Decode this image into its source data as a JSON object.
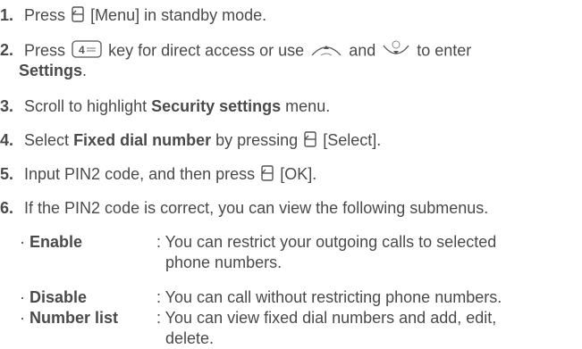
{
  "steps": [
    {
      "num": "1.",
      "pre": "Press",
      "post": "[Menu] in standby mode."
    },
    {
      "num": "2.",
      "pre": "Press",
      "mid1": "key for direct access or use",
      "mid2": "and",
      "post": "to enter",
      "bold_line2": "Settings",
      "tail_line2": "."
    },
    {
      "num": "3.",
      "pre": "Scroll to highlight",
      "bold": "Security settings",
      "post": "menu."
    },
    {
      "num": "4.",
      "pre": "Select",
      "bold": "Fixed dial number",
      "mid": "by pressing",
      "post": "[Select]."
    },
    {
      "num": "5.",
      "pre": "Input PIN2 code, and then press",
      "post": "[OK]."
    },
    {
      "num": "6.",
      "text": "If the PIN2 code is correct, you can view the following submenus."
    }
  ],
  "submenus": [
    {
      "bullet": "·",
      "name": "Enable",
      "desc1": ": You can restrict your outgoing calls to selected",
      "desc2": "phone numbers."
    },
    {
      "bullet": "·",
      "name": "Disable",
      "desc1": ": You can call without restricting phone numbers."
    },
    {
      "bullet": "·",
      "name": "Number list",
      "desc1": ": You can view fixed dial numbers and add, edit,",
      "desc2": "delete."
    }
  ],
  "icons": {
    "softkey": "left-softkey-icon",
    "key4": "key-4-ghi-icon",
    "nav_up": "nav-up-key-icon",
    "nav_down": "nav-down-ok-key-icon",
    "key4_text": "4"
  }
}
